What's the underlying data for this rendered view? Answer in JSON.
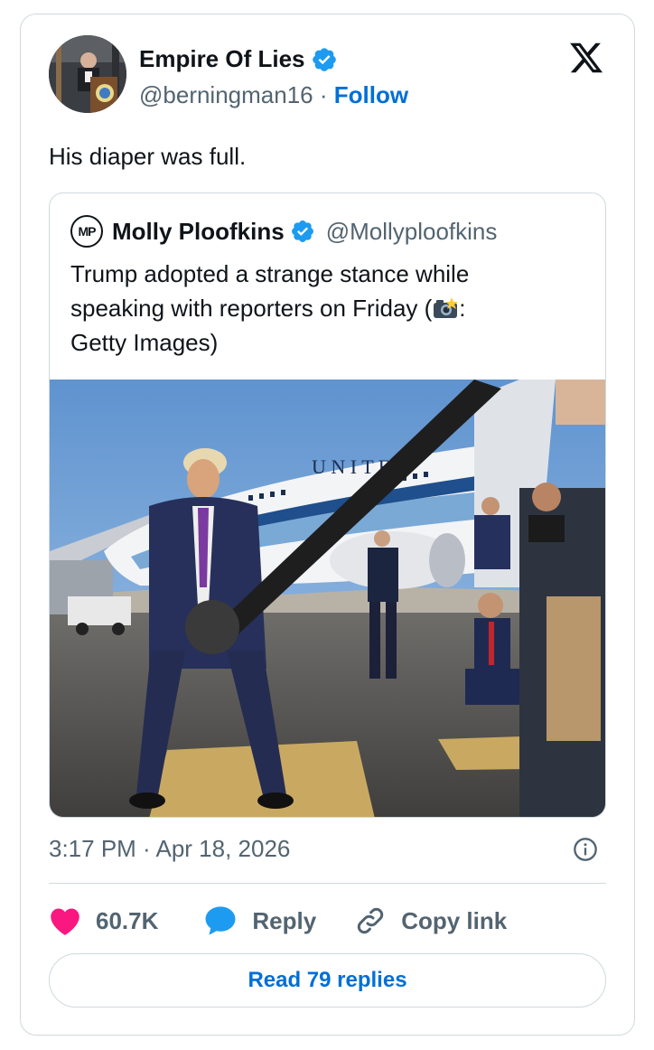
{
  "tweet": {
    "author_name": "Empire Of Lies",
    "handle": "@berningman16",
    "separator": "·",
    "follow_label": "Follow",
    "text": "His diaper was full.",
    "timestamp": "3:17 PM · Apr 18, 2026"
  },
  "quoted_tweet": {
    "avatar_initials": "MP",
    "author_name": "Molly Ploofkins",
    "handle": "@Mollyploofkins",
    "text_line1": "Trump adopted a strange stance while",
    "text_line2_a": "speaking with reporters on Friday (",
    "text_line2_b": ":",
    "text_line3": "Getty Images)",
    "photo_aircraft_lettering": "UNITED"
  },
  "actions": {
    "like_count": "60.7K",
    "reply_label": "Reply",
    "copy_label": "Copy link",
    "read_replies_label": "Read 79 replies"
  },
  "colors": {
    "accent_blue": "#006fd6",
    "verified_blue": "#1d9bf0",
    "like_pink": "#f91880",
    "text_secondary": "#536471",
    "border": "#cfd9de"
  },
  "icons": {
    "logo": "x-logo-icon",
    "verified": "verified-badge-icon",
    "like": "heart-icon",
    "reply": "speech-bubble-icon",
    "copy": "link-icon",
    "info": "info-icon",
    "camera": "camera-flash-icon"
  }
}
